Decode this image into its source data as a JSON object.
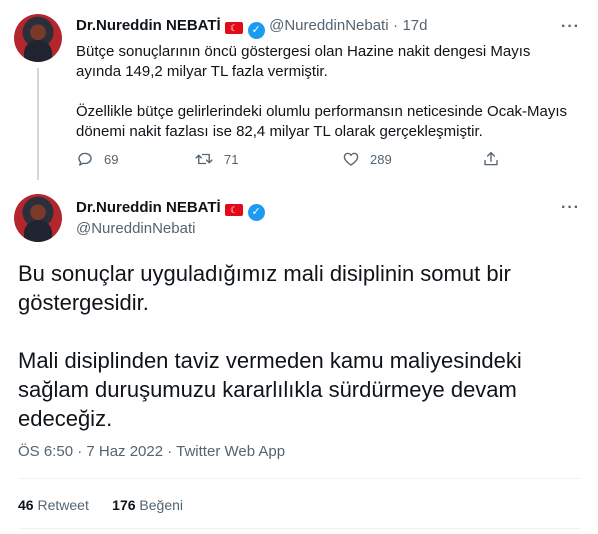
{
  "tweet1": {
    "name": "Dr.Nureddin NEBATİ",
    "handle": "@NureddinNebati",
    "separator": "·",
    "time": "17d",
    "paragraphs": [
      "Bütçe sonuçlarının öncü göstergesi olan Hazine nakit dengesi Mayıs ayında 149,2 milyar TL fazla vermiştir.",
      "Özellikle bütçe gelirlerindeki olumlu performansın neticesinde Ocak-Mayıs dönemi nakit fazlası ise 82,4 milyar TL olarak gerçekleşmiştir."
    ],
    "replies": "69",
    "retweets": "71",
    "likes": "289"
  },
  "tweet2": {
    "name": "Dr.Nureddin NEBATİ",
    "handle": "@NureddinNebati",
    "paragraphs": [
      "Bu sonuçlar uyguladığımız mali disiplinin somut bir göstergesidir.",
      "Mali disiplinden taviz vermeden kamu maliyesindeki sağlam duruşumuzu kararlılıkla sürdürmeye devam edeceğiz."
    ],
    "timestamp": "ÖS 6:50 · 7 Haz 2022 · Twitter Web App",
    "retweet_count": "46",
    "retweet_label": "Retweet",
    "like_count": "176",
    "like_label": "Beğeni"
  },
  "icons": {
    "reply": "reply-icon",
    "retweet": "retweet-icon",
    "like": "heart-icon",
    "share": "share-icon",
    "more": "more-icon",
    "verified": "verified-badge-icon",
    "flag": "turkey-flag-icon"
  },
  "colors": {
    "verified": "#1d9bf0",
    "secondary_text": "#536471",
    "flag": "#e30a17"
  }
}
